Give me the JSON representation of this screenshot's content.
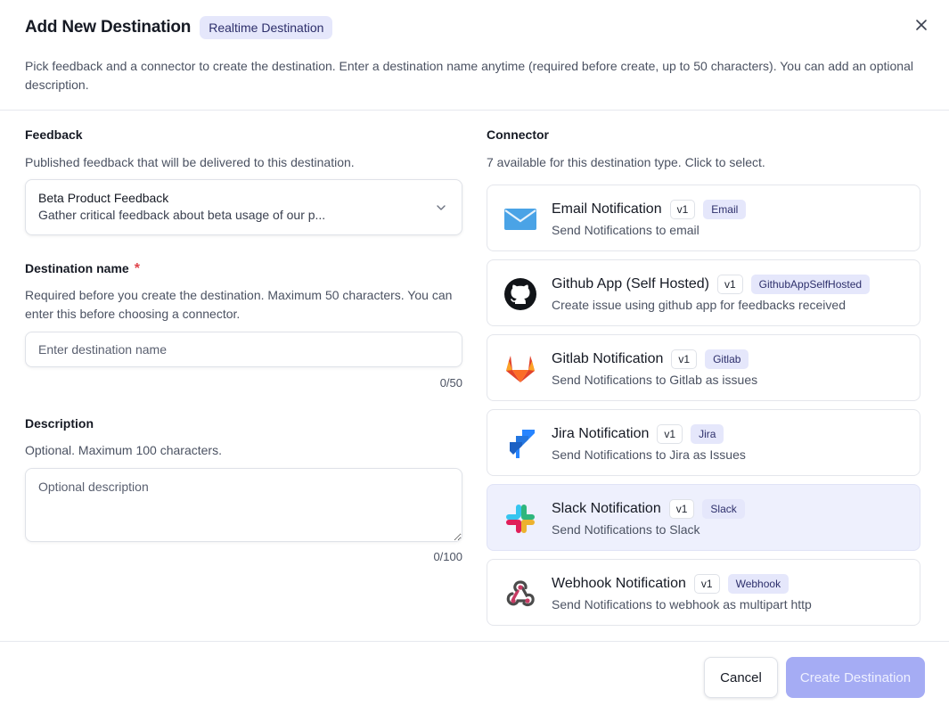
{
  "header": {
    "title": "Add New Destination",
    "badge": "Realtime Destination",
    "subtitle": "Pick feedback and a connector to create the destination. Enter a destination name anytime (required before create, up to 50 characters). You can add an optional description."
  },
  "feedback": {
    "label": "Feedback",
    "help": "Published feedback that will be delivered to this destination.",
    "selected_title": "Beta Product Feedback",
    "selected_desc": "Gather critical feedback about beta usage of our p..."
  },
  "destination_name": {
    "label": "Destination name",
    "required_mark": "*",
    "help": "Required before you create the destination. Maximum 50 characters. You can enter this before choosing a connector.",
    "placeholder": "Enter destination name",
    "value": "",
    "counter": "0/50"
  },
  "description": {
    "label": "Description",
    "help": "Optional. Maximum 100 characters.",
    "placeholder": "Optional description",
    "value": "",
    "counter": "0/100"
  },
  "connector": {
    "label": "Connector",
    "help": "7 available for this destination type. Click to select.",
    "items": [
      {
        "name": "Email Notification",
        "version": "v1",
        "type": "Email",
        "desc": "Send Notifications to email",
        "icon": "email-icon",
        "selected": false
      },
      {
        "name": "Github App (Self Hosted)",
        "version": "v1",
        "type": "GithubAppSelfHosted",
        "desc": "Create issue using github app for feedbacks received",
        "icon": "github-icon",
        "selected": false
      },
      {
        "name": "Gitlab Notification",
        "version": "v1",
        "type": "Gitlab",
        "desc": "Send Notifications to Gitlab as issues",
        "icon": "gitlab-icon",
        "selected": false
      },
      {
        "name": "Jira Notification",
        "version": "v1",
        "type": "Jira",
        "desc": "Send Notifications to Jira as Issues",
        "icon": "jira-icon",
        "selected": false
      },
      {
        "name": "Slack Notification",
        "version": "v1",
        "type": "Slack",
        "desc": "Send Notifications to Slack",
        "icon": "slack-icon",
        "selected": true
      },
      {
        "name": "Webhook Notification",
        "version": "v1",
        "type": "Webhook",
        "desc": "Send Notifications to webhook as multipart http",
        "icon": "webhook-icon",
        "selected": false
      }
    ]
  },
  "footer": {
    "cancel": "Cancel",
    "create": "Create Destination"
  },
  "colors": {
    "accent": "#a5acf4",
    "badge_bg": "#e5e7fb",
    "selected_bg": "#eef0fd",
    "required": "#e0454c"
  }
}
